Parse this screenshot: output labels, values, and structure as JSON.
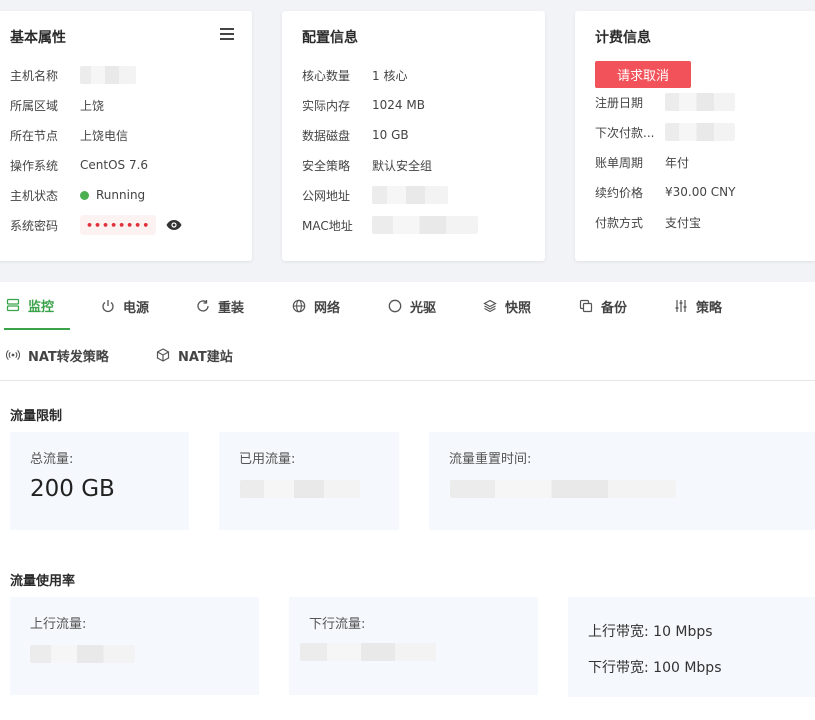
{
  "basic": {
    "title": "基本属性",
    "rows": [
      {
        "label": "主机名称",
        "value": ""
      },
      {
        "label": "所属区域",
        "value": "上饶"
      },
      {
        "label": "所在节点",
        "value": "上饶电信"
      },
      {
        "label": "操作系统",
        "value": "CentOS 7.6"
      },
      {
        "label": "主机状态",
        "value": "Running"
      },
      {
        "label": "系统密码",
        "value": "••••••••"
      }
    ],
    "status_color": "#4caf50"
  },
  "config": {
    "title": "配置信息",
    "rows": [
      {
        "label": "核心数量",
        "value": "1 核心"
      },
      {
        "label": "实际内存",
        "value": "1024 MB"
      },
      {
        "label": "数据磁盘",
        "value": "10 GB"
      },
      {
        "label": "安全策略",
        "value": "默认安全组"
      },
      {
        "label": "公网地址",
        "value": ""
      },
      {
        "label": "MAC地址",
        "value": ""
      }
    ]
  },
  "billing": {
    "title": "计费信息",
    "cancel_button": "请求取消",
    "rows": [
      {
        "label": "注册日期",
        "value": ""
      },
      {
        "label": "下次付款...",
        "value": ""
      },
      {
        "label": "账单周期",
        "value": "年付"
      },
      {
        "label": "续约价格",
        "value": "¥30.00 CNY"
      },
      {
        "label": "付款方式",
        "value": "支付宝"
      }
    ]
  },
  "tabs": [
    {
      "label": "监控",
      "icon": "server-icon",
      "active": true
    },
    {
      "label": "电源",
      "icon": "power-icon"
    },
    {
      "label": "重装",
      "icon": "refresh-icon"
    },
    {
      "label": "网络",
      "icon": "globe-icon"
    },
    {
      "label": "光驱",
      "icon": "disc-icon"
    },
    {
      "label": "快照",
      "icon": "layers-icon"
    },
    {
      "label": "备份",
      "icon": "copy-icon"
    },
    {
      "label": "策略",
      "icon": "sliders-icon"
    },
    {
      "label": "NAT转发策略",
      "icon": "broadcast-icon"
    },
    {
      "label": "NAT建站",
      "icon": "cube-icon"
    }
  ],
  "traffic_limit": {
    "title": "流量限制",
    "total_label": "总流量:",
    "total_value": "200 GB",
    "used_label": "已用流量:",
    "reset_label": "流量重置时间:"
  },
  "traffic_usage": {
    "title": "流量使用率",
    "up_label": "上行流量:",
    "down_label": "下行流量:",
    "up_bw_label": "上行带宽:",
    "up_bw_value": "10 Mbps",
    "down_bw_label": "下行带宽:",
    "down_bw_value": "100 Mbps"
  },
  "colors": {
    "accent": "#3aa34a",
    "danger": "#f2525a"
  }
}
